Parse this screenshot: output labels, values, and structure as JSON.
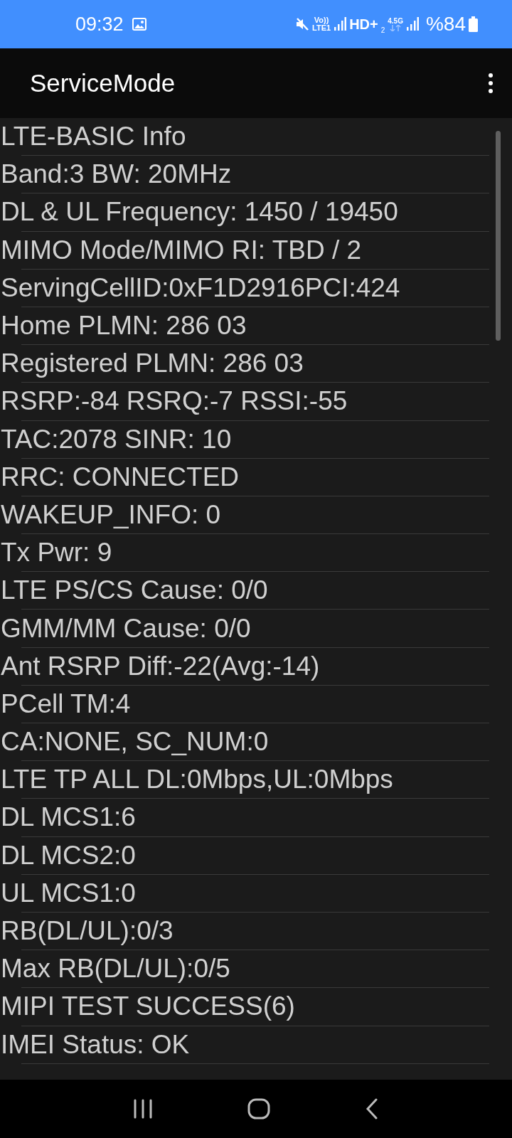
{
  "status_bar": {
    "time": "09:32",
    "volte_top": "Vo))",
    "volte_bottom": "LTE1",
    "hd": "HD+",
    "sim2": "2",
    "network": "4.5G",
    "battery": "%84"
  },
  "app_bar": {
    "title": "ServiceMode"
  },
  "info_lines": [
    "LTE-BASIC Info",
    "Band:3 BW: 20MHz",
    "DL & UL Frequency: 1450 / 19450",
    "MIMO Mode/MIMO RI: TBD / 2",
    "ServingCellID:0xF1D2916PCI:424",
    "Home PLMN: 286 03",
    "Registered PLMN: 286 03",
    "RSRP:-84 RSRQ:-7 RSSI:-55",
    "TAC:2078 SINR: 10",
    "RRC: CONNECTED",
    "WAKEUP_INFO: 0",
    "Tx Pwr: 9",
    "LTE PS/CS Cause: 0/0",
    "GMM/MM Cause: 0/0",
    "Ant RSRP Diff:-22(Avg:-14)",
    "PCell TM:4",
    "CA:NONE, SC_NUM:0",
    "LTE TP ALL DL:0Mbps,UL:0Mbps",
    "DL MCS1:6",
    "DL MCS2:0",
    "UL MCS1:0",
    "RB(DL/UL):0/3",
    "Max RB(DL/UL):0/5",
    "MIPI TEST SUCCESS(6)",
    "IMEI Status: OK"
  ]
}
